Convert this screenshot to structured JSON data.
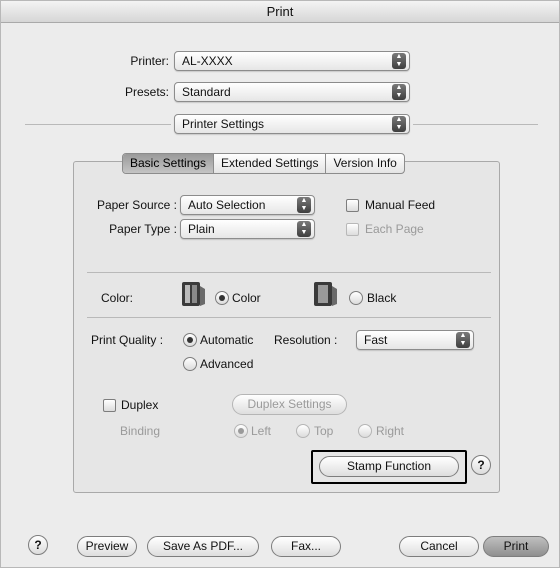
{
  "window": {
    "title": "Print"
  },
  "printer": {
    "label": "Printer:",
    "value": "AL-XXXX"
  },
  "presets": {
    "label": "Presets:",
    "value": "Standard"
  },
  "panel_select": {
    "value": "Printer Settings"
  },
  "tabs": [
    {
      "label": "Basic Settings",
      "active": true
    },
    {
      "label": "Extended Settings",
      "active": false
    },
    {
      "label": "Version Info",
      "active": false
    }
  ],
  "paper_source": {
    "label": "Paper Source :",
    "value": "Auto Selection"
  },
  "paper_type": {
    "label": "Paper Type :",
    "value": "Plain"
  },
  "manual_feed": {
    "label": "Manual Feed",
    "checked": false
  },
  "each_page": {
    "label": "Each Page",
    "checked": false,
    "enabled": false
  },
  "color": {
    "label": "Color:",
    "options": [
      {
        "label": "Color",
        "selected": true,
        "icon": "color-ink-icon"
      },
      {
        "label": "Black",
        "selected": false,
        "icon": "black-ink-icon"
      }
    ]
  },
  "print_quality": {
    "label": "Print Quality :",
    "options": [
      {
        "label": "Automatic",
        "selected": true
      },
      {
        "label": "Advanced",
        "selected": false
      }
    ],
    "resolution_label": "Resolution :",
    "resolution_value": "Fast"
  },
  "duplex": {
    "label": "Duplex",
    "checked": false,
    "settings_button": "Duplex Settings",
    "binding_label": "Binding",
    "binding_options": [
      {
        "label": "Left",
        "selected": true
      },
      {
        "label": "Top",
        "selected": false
      },
      {
        "label": "Right",
        "selected": false
      }
    ]
  },
  "stamp_function": {
    "label": "Stamp Function"
  },
  "footer": {
    "help": "?",
    "preview": "Preview",
    "save_pdf": "Save As PDF...",
    "fax": "Fax...",
    "cancel": "Cancel",
    "print": "Print"
  },
  "help_symbol": "?"
}
